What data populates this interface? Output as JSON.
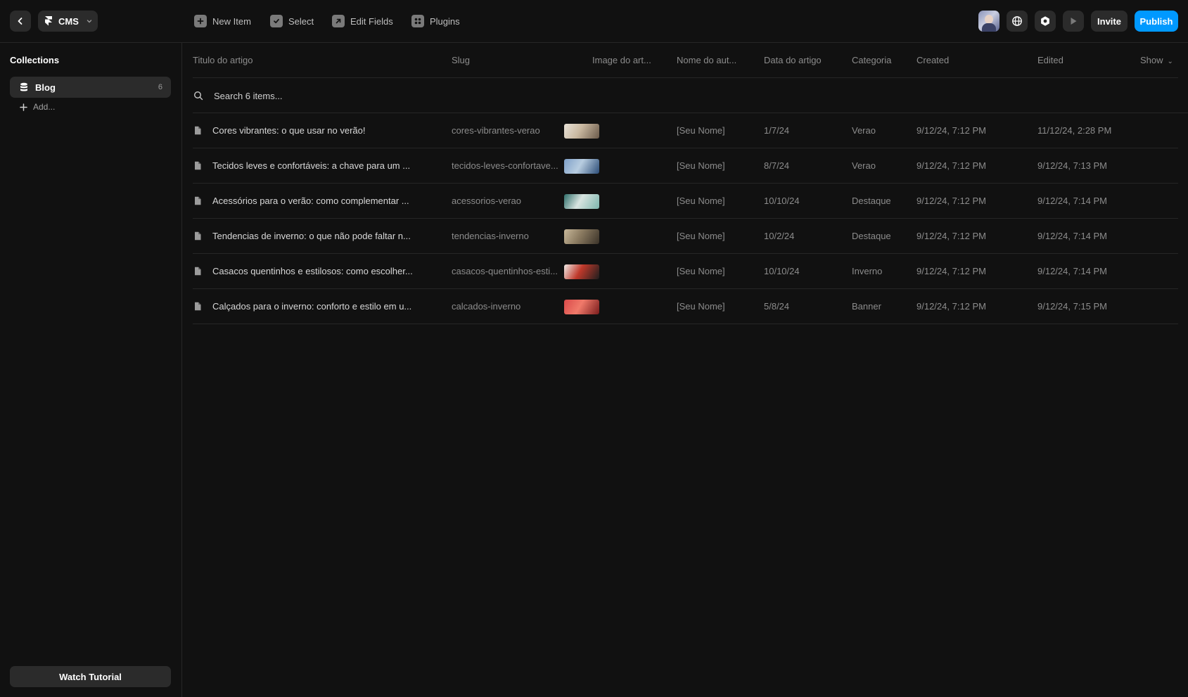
{
  "header": {
    "app_name": "CMS",
    "toolbar": [
      {
        "label": "New Item",
        "icon": "plus-square-icon"
      },
      {
        "label": "Select",
        "icon": "checkbox-icon"
      },
      {
        "label": "Edit Fields",
        "icon": "arrow-up-right-square-icon"
      },
      {
        "label": "Plugins",
        "icon": "plugins-grid-icon"
      }
    ],
    "invite_label": "Invite",
    "publish_label": "Publish"
  },
  "sidebar": {
    "title": "Collections",
    "collections": [
      {
        "name": "Blog",
        "count": "6"
      }
    ],
    "add_label": "Add...",
    "watch_label": "Watch Tutorial"
  },
  "table": {
    "columns": [
      "Titulo do artigo",
      "Slug",
      "Image do art...",
      "Nome do aut...",
      "Data do artigo",
      "Categoria",
      "Created",
      "Edited"
    ],
    "show_label": "Show",
    "search_placeholder": "Search 6 items...",
    "rows": [
      {
        "title": "Cores vibrantes: o que usar no verão!",
        "slug": "cores-vibrantes-verao",
        "author": "[Seu Nome]",
        "date": "1/7/24",
        "category": "Verao",
        "created": "9/12/24, 7:12 PM",
        "edited": "11/12/24, 2:28 PM",
        "thumb_colors": [
          "#e8e2d8",
          "#6b5a4a",
          "#c9b8a0"
        ]
      },
      {
        "title": "Tecidos leves e confortáveis: a chave para um ...",
        "slug": "tecidos-leves-confortave...",
        "author": "[Seu Nome]",
        "date": "8/7/24",
        "category": "Verao",
        "created": "9/12/24, 7:12 PM",
        "edited": "9/12/24, 7:13 PM",
        "thumb_colors": [
          "#7fa0c8",
          "#2c4d78",
          "#b8cde0"
        ]
      },
      {
        "title": "Acessórios para o verão: como complementar ...",
        "slug": "acessorios-verao",
        "author": "[Seu Nome]",
        "date": "10/10/24",
        "category": "Destaque",
        "created": "9/12/24, 7:12 PM",
        "edited": "9/12/24, 7:14 PM",
        "thumb_colors": [
          "#2e6e6a",
          "#7db5ad",
          "#d8e4e0"
        ]
      },
      {
        "title": "Tendencias de inverno: o que não pode faltar n...",
        "slug": "tendencias-inverno",
        "author": "[Seu Nome]",
        "date": "10/2/24",
        "category": "Destaque",
        "created": "9/12/24, 7:12 PM",
        "edited": "9/12/24, 7:14 PM",
        "thumb_colors": [
          "#c8b89a",
          "#3a3228",
          "#8a7a60"
        ]
      },
      {
        "title": "Casacos quentinhos e estilosos: como escolher...",
        "slug": "casacos-quentinhos-esti...",
        "author": "[Seu Nome]",
        "date": "10/10/24",
        "category": "Inverno",
        "created": "9/12/24, 7:12 PM",
        "edited": "9/12/24, 7:14 PM",
        "thumb_colors": [
          "#f0ece8",
          "#1e1e1e",
          "#c0392b"
        ]
      },
      {
        "title": "Calçados para o inverno: conforto e estilo em u...",
        "slug": "calcados-inverno",
        "author": "[Seu Nome]",
        "date": "5/8/24",
        "category": "Banner",
        "created": "9/12/24, 7:12 PM",
        "edited": "9/12/24, 7:15 PM",
        "thumb_colors": [
          "#d94a4a",
          "#7a1c1c",
          "#f07a6a"
        ]
      }
    ]
  },
  "colors": {
    "background": "#111111",
    "surface": "#2b2b2b",
    "accent": "#0099ff",
    "border": "#262626"
  }
}
